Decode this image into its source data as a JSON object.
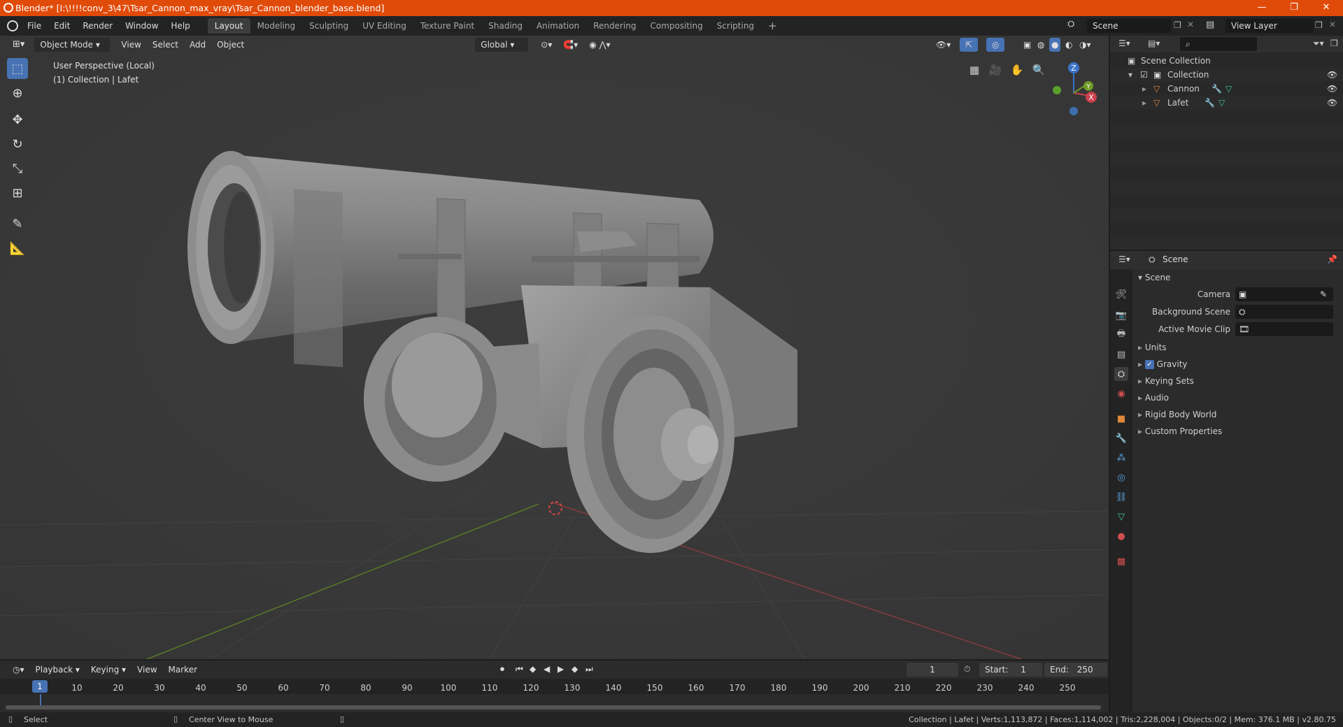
{
  "window": {
    "title": "Blender* [I:\\!!!!conv_3\\47\\Tsar_Cannon_max_vray\\Tsar_Cannon_blender_base.blend]",
    "controls": [
      "—",
      "❐",
      "✕"
    ]
  },
  "menus": [
    "File",
    "Edit",
    "Render",
    "Window",
    "Help"
  ],
  "workspaces": [
    "Layout",
    "Modeling",
    "Sculpting",
    "UV Editing",
    "Texture Paint",
    "Shading",
    "Animation",
    "Rendering",
    "Compositing",
    "Scripting"
  ],
  "workspace_add": "+",
  "scene_field": "Scene",
  "view_layer_field": "View Layer",
  "viewport": {
    "mode": "Object Mode",
    "menus": [
      "View",
      "Select",
      "Add",
      "Object"
    ],
    "orientation": "Global",
    "info_line1": "User Perspective (Local)",
    "info_line2": "(1) Collection | Lafet",
    "gizmo": {
      "z": "Z",
      "y": "Y",
      "x": "X"
    }
  },
  "outliner": {
    "root": "Scene Collection",
    "collection": "Collection",
    "objects": [
      "Cannon",
      "Lafet"
    ]
  },
  "properties": {
    "header": "Scene",
    "panel": "Scene",
    "fields": [
      {
        "label": "Camera"
      },
      {
        "label": "Background Scene"
      },
      {
        "label": "Active Movie Clip"
      }
    ],
    "sections": [
      "Units",
      "Gravity",
      "Keying Sets",
      "Audio",
      "Rigid Body World",
      "Custom Properties"
    ],
    "gravity_checked": true
  },
  "timeline": {
    "menus": [
      "Playback",
      "Keying",
      "View",
      "Marker"
    ],
    "current_frame": "1",
    "start_label": "Start:",
    "start": "1",
    "end_label": "End:",
    "end": "250",
    "ruler_current": "1",
    "ruler": [
      "10",
      "20",
      "30",
      "40",
      "50",
      "60",
      "70",
      "80",
      "90",
      "100",
      "110",
      "120",
      "130",
      "140",
      "150",
      "160",
      "170",
      "180",
      "190",
      "200",
      "210",
      "220",
      "230",
      "240",
      "250"
    ]
  },
  "status": {
    "left1": "Select",
    "left2": "Center View to Mouse",
    "right": "Collection | Lafet | Verts:1,113,872 | Faces:1,114,002 | Tris:2,228,004 | Objects:0/2 | Mem: 376.1 MB | v2.80.75"
  },
  "colors": {
    "titlebar": "#e14b0a",
    "accent": "#4772b3",
    "x_axis": "#c8414b",
    "y_axis": "#6e9a26",
    "z_axis": "#3a73c8"
  }
}
